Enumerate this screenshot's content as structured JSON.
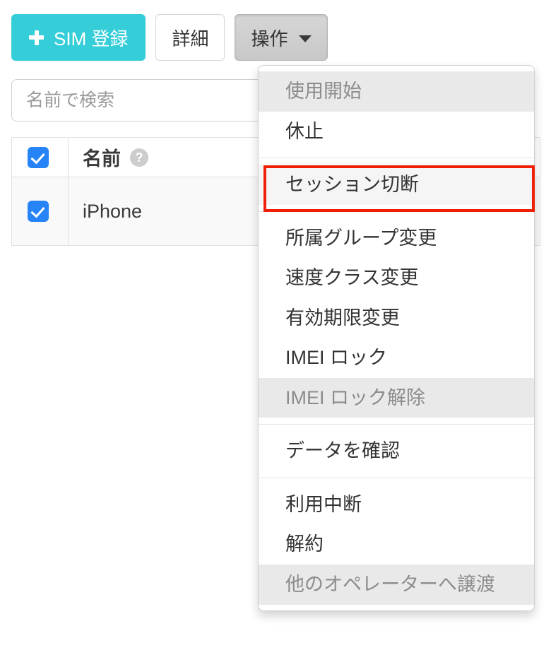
{
  "toolbar": {
    "add_sim_label": "SIM 登録",
    "add_sim_icon": "plus-icon",
    "detail_label": "詳細",
    "action_label": "操作",
    "action_caret_icon": "chevron-down-icon",
    "primary_color": "#35cdd8"
  },
  "search": {
    "value": "",
    "placeholder": "名前で検索"
  },
  "table": {
    "columns": [
      "",
      "名前"
    ],
    "header_help_icon": "help-circle-icon",
    "header_checkbox_checked": true,
    "rows": [
      {
        "checked": true,
        "name": "iPhone"
      }
    ]
  },
  "dropdown": {
    "groups": [
      {
        "items": [
          {
            "label": "使用開始",
            "state": "disabled"
          },
          {
            "label": "休止",
            "state": "normal"
          }
        ]
      },
      {
        "items": [
          {
            "label": "セッション切断",
            "state": "highlighted"
          }
        ]
      },
      {
        "items": [
          {
            "label": "所属グループ変更",
            "state": "normal"
          },
          {
            "label": "速度クラス変更",
            "state": "normal"
          },
          {
            "label": "有効期限変更",
            "state": "normal"
          },
          {
            "label": "IMEI ロック",
            "state": "normal"
          },
          {
            "label": "IMEI ロック解除",
            "state": "disabled"
          }
        ]
      },
      {
        "items": [
          {
            "label": "データを確認",
            "state": "normal"
          }
        ]
      },
      {
        "items": [
          {
            "label": "利用中断",
            "state": "normal"
          },
          {
            "label": "解約",
            "state": "normal"
          },
          {
            "label": "他のオペレーターへ譲渡",
            "state": "disabled"
          }
        ]
      }
    ],
    "annotation_color": "#ef2006"
  },
  "icons": {
    "help": "?"
  }
}
